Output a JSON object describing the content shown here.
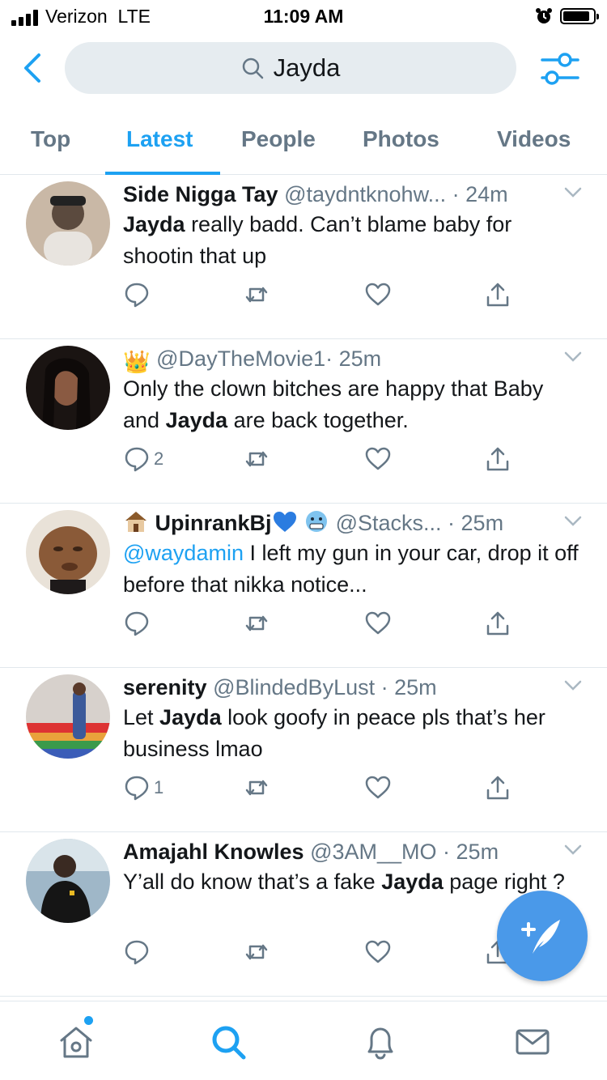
{
  "status_bar": {
    "carrier": "Verizon  LTE",
    "time": "11:09 AM",
    "battery_level": 0.9,
    "icons": [
      "signal-bars-icon",
      "alarm-icon",
      "battery-icon"
    ]
  },
  "search": {
    "query": "Jayda",
    "icons": [
      "back-chevron-icon",
      "search-icon",
      "filter-sliders-icon"
    ]
  },
  "tabs": [
    {
      "label": "Top",
      "active": false
    },
    {
      "label": "Latest",
      "active": true
    },
    {
      "label": "People",
      "active": false
    },
    {
      "label": "Photos",
      "active": false
    },
    {
      "label": "Videos",
      "active": false
    }
  ],
  "tweets": [
    {
      "name": "Side Nigga Tay",
      "handle": "@taydntknohw...",
      "time": "· 24m",
      "text_parts": [
        "",
        "Jayda",
        " really badd. Can’t blame baby for shootin that up"
      ],
      "reply_count": "",
      "avatar_color": "#5b4a3e"
    },
    {
      "name": "👑",
      "handle": "@DayTheMovie1",
      "time": "· 25m",
      "text_parts": [
        "Only the clown bitches are happy that Baby and ",
        "Jayda",
        " are back together."
      ],
      "reply_count": "2",
      "avatar_color": "#2a1e1a"
    },
    {
      "name": "UpinrankBj",
      "handle": "@Stacks...",
      "time": "· 25m",
      "mention": "@waydamin",
      "text_parts": [
        "",
        "",
        " I left my gun in your car, drop it off before that nikka notice..."
      ],
      "reply_count": "",
      "avatar_color": "#8a5a38"
    },
    {
      "name": "serenity",
      "handle": "@BlindedByLust",
      "time": "· 25m",
      "text_parts": [
        "Let ",
        "Jayda",
        " look goofy in peace pls that’s her business lmao"
      ],
      "reply_count": "1",
      "avatar_color": "#7a6a80"
    },
    {
      "name": "Amajahl Knowles",
      "handle": "@3AM__MO",
      "time": "· 25m",
      "text_parts": [
        "Y’all do know that’s a fake ",
        "Jayda",
        " page right ?"
      ],
      "reply_count": "",
      "avatar_color": "#2c3540"
    }
  ],
  "tweet_action_icons": [
    "reply-icon",
    "retweet-icon",
    "like-icon",
    "share-icon"
  ],
  "fab": {
    "icon": "compose-tweet-icon"
  },
  "tab_bar": {
    "icons": [
      "home-icon",
      "search-icon",
      "notifications-bell-icon",
      "messages-envelope-icon"
    ],
    "active": "search-icon",
    "home_has_new": true
  },
  "colors": {
    "accent": "#1da1f2",
    "fab": "#4a99e9",
    "secondary_text": "#657786",
    "search_bg": "#e6ecf0"
  }
}
